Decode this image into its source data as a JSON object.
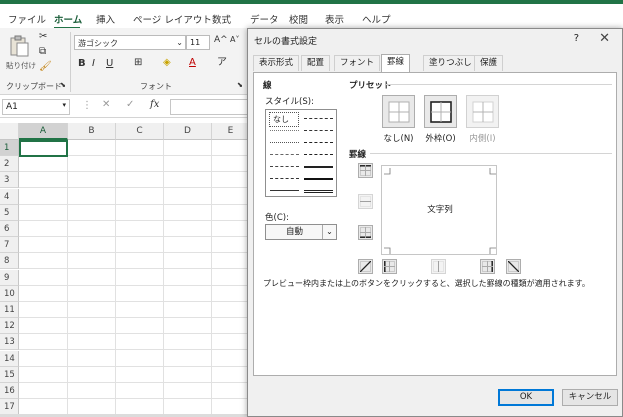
{
  "ribbon_tabs": [
    "ファイル",
    "ホーム",
    "挿入",
    "ページ レイアウト",
    "数式",
    "データ",
    "校閲",
    "表示",
    "ヘルプ"
  ],
  "ribbon": {
    "paste_label": "貼り付け",
    "clipboard_group": "クリップボード",
    "font_name": "游ゴシック",
    "font_size": "11",
    "font_group": "フォント",
    "grow_font": "A^",
    "shrink_font": "A˅"
  },
  "formula_bar": {
    "name_box": "A1",
    "fx": "fx"
  },
  "grid": {
    "columns": [
      "A",
      "B",
      "C",
      "D",
      "E"
    ],
    "rows": [
      "1",
      "2",
      "3",
      "4",
      "5",
      "6",
      "7",
      "8",
      "9",
      "10",
      "11",
      "12",
      "13",
      "14",
      "15",
      "16",
      "17"
    ],
    "selected_cell": "A1"
  },
  "dialog": {
    "title": "セルの書式設定",
    "help": "?",
    "close": "✕",
    "tabs": [
      "表示形式",
      "配置",
      "フォント",
      "罫線",
      "塗りつぶし",
      "保護"
    ],
    "active_tab": "罫線",
    "line_section": "線",
    "style_label": "スタイル(S):",
    "none_style": "なし",
    "color_label": "色(C):",
    "color_value": "自動",
    "presets_section": "プリセット",
    "presets": [
      {
        "label": "なし(N)",
        "enabled": true
      },
      {
        "label": "外枠(O)",
        "enabled": true
      },
      {
        "label": "内側(I)",
        "enabled": false
      }
    ],
    "border_section": "罫線",
    "preview_text": "文字列",
    "hint": "プレビュー枠内または上のボタンをクリックすると、選択した罫線の種類が適用されます。",
    "ok": "OK",
    "cancel": "キャンセル"
  }
}
